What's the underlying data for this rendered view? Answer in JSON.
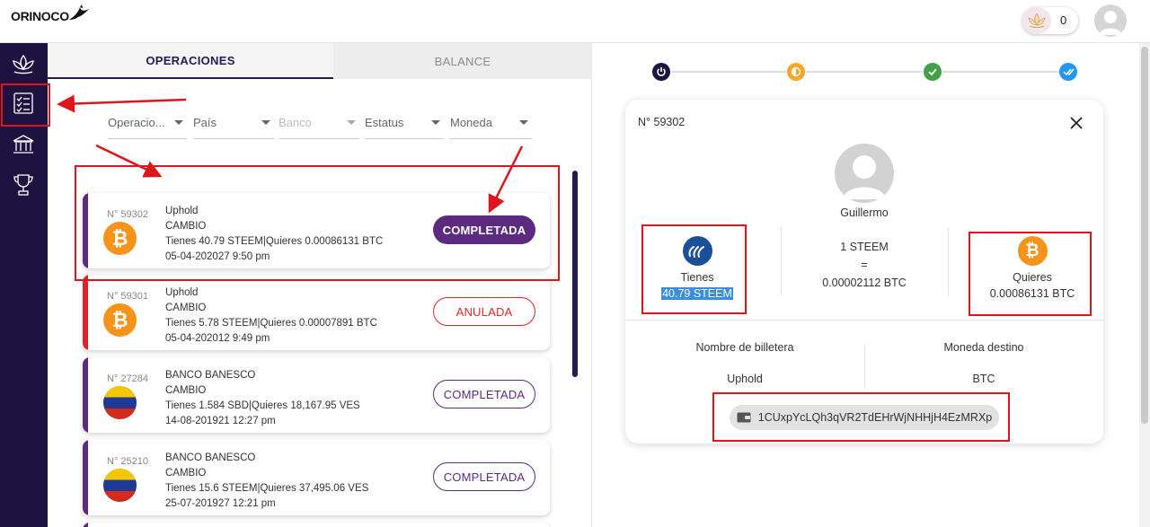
{
  "brand": {
    "logo_text": "ORINOCO"
  },
  "topbar": {
    "notification_count": "0"
  },
  "sidebar": {
    "items": [
      {
        "name": "lotus-icon"
      },
      {
        "name": "checklist-icon"
      },
      {
        "name": "bank-icon"
      },
      {
        "name": "trophy-icon"
      }
    ]
  },
  "tabs": [
    {
      "label": "OPERACIONES",
      "active": true
    },
    {
      "label": "BALANCE",
      "active": false
    }
  ],
  "filters": [
    {
      "label": "Operacio..."
    },
    {
      "label": "País"
    },
    {
      "label": "Banco"
    },
    {
      "label": "Estatus"
    },
    {
      "label": "Moneda"
    }
  ],
  "operations": [
    {
      "number": "N° 59302",
      "name": "Uphold",
      "type": "CAMBIO",
      "detail": "Tienes 40.79 STEEM|Quieres 0.00086131 BTC",
      "date": "05-04-202027 9:50 pm",
      "status": "COMPLETADA",
      "status_style": "filled",
      "icon": "bitcoin-icon",
      "accent": "#5c2a7e"
    },
    {
      "number": "N° 59301",
      "name": "Uphold",
      "type": "CAMBIO",
      "detail": "Tienes 5.78 STEEM|Quieres 0.00007891 BTC",
      "date": "05-04-202012 9:49 pm",
      "status": "ANULADA",
      "status_style": "outline-red",
      "icon": "bitcoin-icon",
      "accent": "#d9262c"
    },
    {
      "number": "N° 27284",
      "name": "BANCO BANESCO",
      "type": "CAMBIO",
      "detail": "Tienes 1.584 SBD|Quieres 18,167.95 VES",
      "date": "14-08-201921 12:27 pm",
      "status": "COMPLETADA",
      "status_style": "outline-purple",
      "icon": "venezuela-flag-icon",
      "accent": "#5c2a7e"
    },
    {
      "number": "N° 25210",
      "name": "BANCO BANESCO",
      "type": "CAMBIO",
      "detail": "Tienes 15.6 STEEM|Quieres 37,495.06 VES",
      "date": "25-07-201927 12:21 pm",
      "status": "COMPLETADA",
      "status_style": "outline-purple",
      "icon": "venezuela-flag-icon",
      "accent": "#5c2a7e"
    }
  ],
  "stepper": {
    "steps": [
      {
        "name": "power-icon",
        "color": "#1e1240"
      },
      {
        "name": "half-circle-icon",
        "color": "#f5a623"
      },
      {
        "name": "check-icon",
        "color": "#43a047"
      },
      {
        "name": "double-check-icon",
        "color": "#2196f3"
      }
    ]
  },
  "detail": {
    "number": "N° 59302",
    "user_name": "Guillermo",
    "have_label": "Tienes",
    "have_value": "40.79 STEEM",
    "rate_top": "1 STEEM",
    "rate_eq": "=",
    "rate_bottom": "0.00002112 BTC",
    "want_label": "Quieres",
    "want_value": "0.00086131 BTC",
    "wallet_label": "Nombre de billetera",
    "wallet_value": "Uphold",
    "currency_label": "Moneda destino",
    "currency_value": "BTC",
    "address": "1CUxpYcLQh3qVR2TdEHrWjNHHjH4EzMRXp"
  }
}
